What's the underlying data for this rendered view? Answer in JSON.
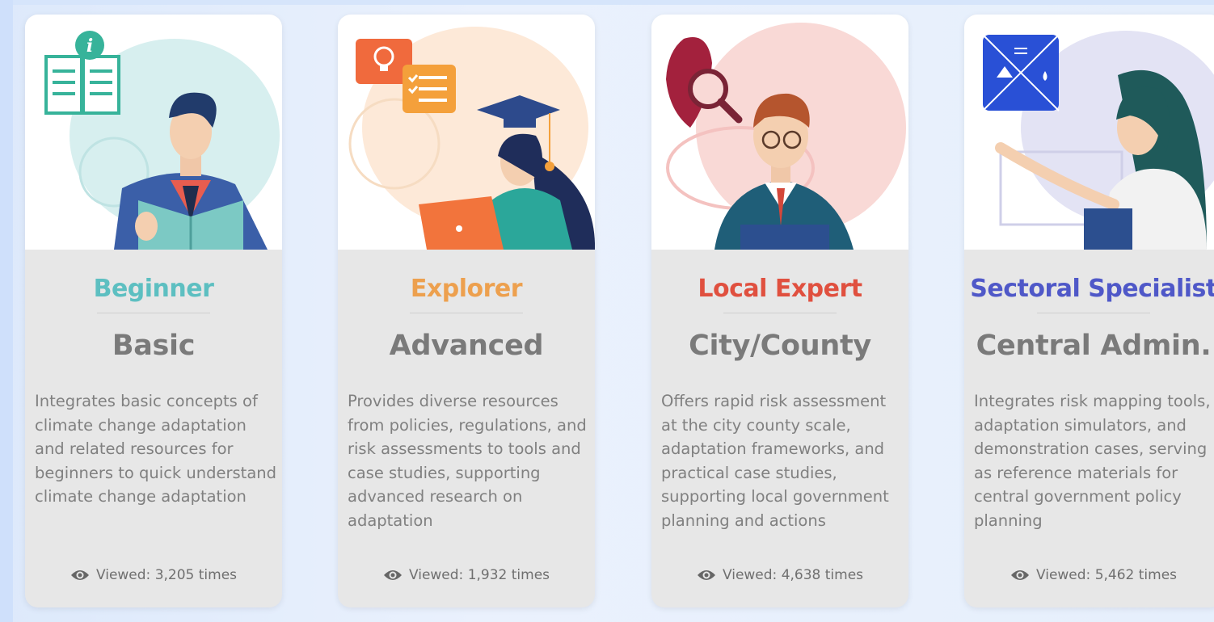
{
  "cards": [
    {
      "role": "Beginner",
      "level": "Basic",
      "description": "Integrates basic concepts of climate change adaptation and related resources for beginners to quick understand climate change adaptation",
      "views": "Viewed: 3,205 times",
      "accent": "#5dbfc1"
    },
    {
      "role": "Explorer",
      "level": "Advanced",
      "description": "Provides diverse resources from policies, regulations, and risk assessments to tools and case studies, supporting advanced research on adaptation",
      "views": "Viewed: 1,932 times",
      "accent": "#eda04e"
    },
    {
      "role": "Local Expert",
      "level": "City/County",
      "description": "Offers rapid risk assessment at the city county scale, adaptation frameworks, and practical case studies, supporting local government planning and actions",
      "views": "Viewed: 4,638 times",
      "accent": "#e0503f"
    },
    {
      "role": "Sectoral Specialist",
      "level": "Central Admin.",
      "description": "Integrates risk mapping tools, adaptation simulators, and demonstration cases, serving as reference materials for central government policy planning",
      "views": "Viewed: 5,462 times",
      "accent": "#4f58c8"
    }
  ],
  "icons": {
    "eye": "eye-icon",
    "book_info": "info-book-icon",
    "lightbulb_chat": "lightbulb-chat-icon",
    "map_search": "map-search-icon",
    "sector_grid": "sector-grid-icon"
  }
}
